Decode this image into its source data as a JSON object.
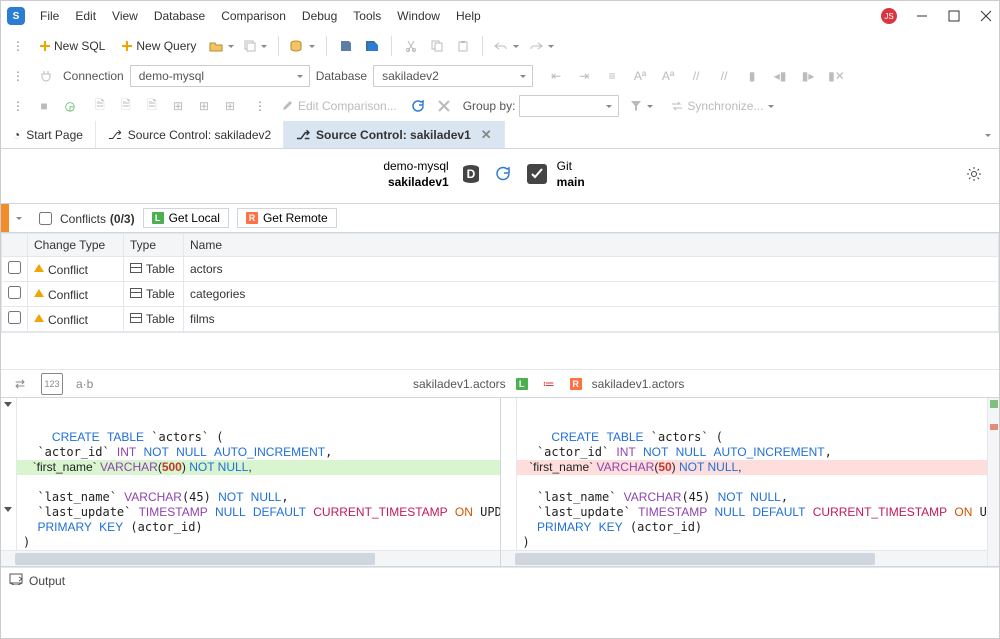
{
  "menu": [
    "File",
    "Edit",
    "View",
    "Database",
    "Comparison",
    "Debug",
    "Tools",
    "Window",
    "Help"
  ],
  "badge": "JS",
  "tb1": {
    "new_sql": "New SQL",
    "new_query": "New Query"
  },
  "conn": {
    "lbl_conn": "Connection",
    "conn_val": "demo-mysql",
    "lbl_db": "Database",
    "db_val": "sakiladev2"
  },
  "tb2": {
    "edit_cmp": "Edit Comparison...",
    "group_by": "Group by:",
    "sync": "Synchronize..."
  },
  "tabs": [
    {
      "icon": "home",
      "label": "Start Page"
    },
    {
      "icon": "sc",
      "label": "Source Control: sakiladev2"
    },
    {
      "icon": "sc",
      "label": "Source Control: sakiladev1",
      "active": true
    }
  ],
  "header": {
    "conn": "demo-mysql",
    "db": "sakiladev1",
    "vcs": "Git",
    "branch": "main"
  },
  "conflicts": {
    "title_a": "Conflicts",
    "title_b": "(0/3)",
    "get_local": "Get Local",
    "get_remote": "Get Remote"
  },
  "columns": {
    "ct": "Change Type",
    "ty": "Type",
    "nm": "Name"
  },
  "rows": [
    {
      "ct": "Conflict",
      "ty": "Table",
      "nm": "actors"
    },
    {
      "ct": "Conflict",
      "ty": "Table",
      "nm": "categories"
    },
    {
      "ct": "Conflict",
      "ty": "Table",
      "nm": "films"
    }
  ],
  "diff": {
    "left_name": "sakiladev1.actors",
    "right_name": "sakiladev1.actors",
    "left_varchar": "500",
    "right_varchar": "50"
  },
  "sidebar_icons": {
    "compare": "⇄",
    "num": "123",
    "ab": "a·b"
  },
  "footer": {
    "output": "Output"
  }
}
